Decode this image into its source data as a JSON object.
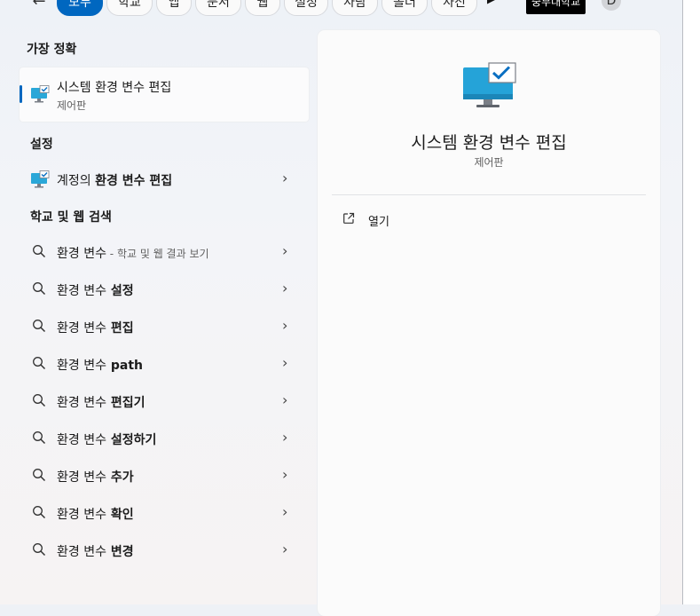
{
  "topbar": {
    "back_icon": "arrow-left-icon",
    "filters": [
      "모두",
      "학교",
      "앱",
      "문서",
      "웹",
      "설정",
      "사람",
      "폴더",
      "사진"
    ],
    "active_filter": "모두",
    "play_icon": "play-icon",
    "school_label": "중부대학교",
    "avatar_initial": "D",
    "more_icon": "more-icon",
    "accent_color": "#0067c0"
  },
  "best_match": {
    "heading": "가장 정확",
    "title": "시스템 환경 변수 편집",
    "subtitle": "제어판",
    "icon": "monitor-check-icon"
  },
  "settings": {
    "heading": "설정",
    "items": [
      {
        "prefix": "계정의 ",
        "bold": "환경 변수 편집",
        "icon": "monitor-check-icon"
      }
    ]
  },
  "web_search": {
    "heading": "학교 및 웹 검색",
    "items": [
      {
        "bold": "환경 변수",
        "rest": "",
        "suffix": " - 학교 및 웹 결과 보기"
      },
      {
        "bold": "환경 변수",
        "rest": " 설정",
        "suffix": ""
      },
      {
        "bold": "환경 변수",
        "rest": " 편집",
        "suffix": ""
      },
      {
        "bold": "환경 변수",
        "rest": " path",
        "suffix": ""
      },
      {
        "bold": "환경 변수",
        "rest": " 편집기",
        "suffix": ""
      },
      {
        "bold": "환경 변수",
        "rest": " 설정하기",
        "suffix": ""
      },
      {
        "bold": "환경 변수",
        "rest": " 추가",
        "suffix": ""
      },
      {
        "bold": "환경 변수",
        "rest": " 확인",
        "suffix": ""
      },
      {
        "bold": "환경 변수",
        "rest": " 변경",
        "suffix": ""
      }
    ]
  },
  "detail": {
    "title": "시스템 환경 변수 편집",
    "subtitle": "제어판",
    "actions": [
      {
        "label": "열기",
        "icon": "open-external-icon"
      }
    ]
  }
}
